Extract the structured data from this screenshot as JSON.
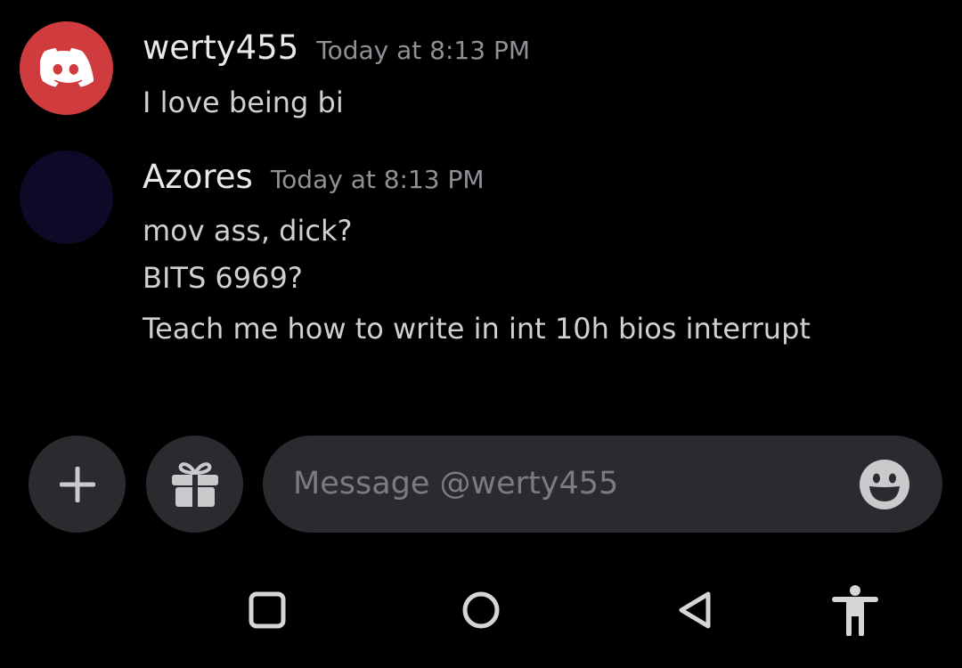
{
  "messages": [
    {
      "username": "werty455",
      "timestamp": "Today at 8:13 PM",
      "lines": [
        "I love being bi"
      ],
      "avatar": "discord-logo-icon",
      "avatar_color": "#d03c3d"
    },
    {
      "username": "Azores",
      "timestamp": "Today at 8:13 PM",
      "lines": [
        "mov ass, dick?",
        "BITS 6969?",
        "Teach me how to write in int 10h bios interrupt"
      ],
      "avatar_color": "#0c0a26"
    }
  ],
  "composer": {
    "placeholder": "Message @werty455",
    "buttons": [
      "plus-icon",
      "gift-icon",
      "emoji-icon"
    ]
  },
  "navbar": {
    "buttons": [
      "recent-apps-icon",
      "home-icon",
      "back-icon",
      "accessibility-icon"
    ]
  },
  "colors": {
    "background": "#000000",
    "pill": "#2a2b2f",
    "username": "#e8e9ea",
    "timestamp": "#8e9297",
    "text": "#cfd0d2"
  }
}
